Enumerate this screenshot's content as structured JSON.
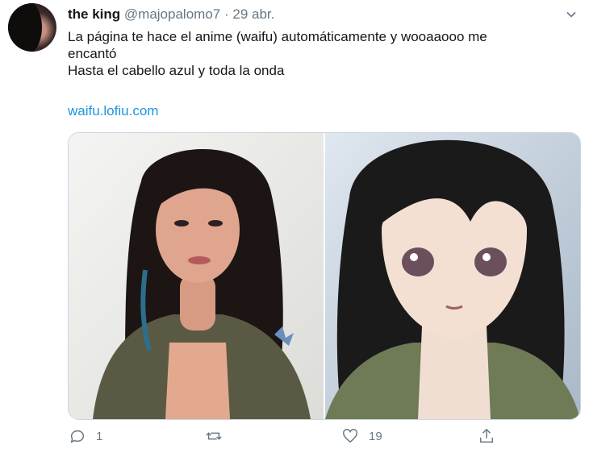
{
  "tweet": {
    "display_name": "the king",
    "handle": "@majopalomo7",
    "separator": "·",
    "date": "29 abr.",
    "text_lines": [
      "La página te hace el anime (waifu) automáticamente y wooaaooo me",
      "encantó",
      "Hasta el cabello azul y toda la onda"
    ],
    "link": "waifu.lofiu.com"
  },
  "actions": {
    "reply_count": "1",
    "retweet_count": "",
    "like_count": "19"
  },
  "icons": {
    "menu": "chevron-down-icon",
    "reply": "reply-icon",
    "retweet": "retweet-icon",
    "like": "heart-icon",
    "share": "share-icon"
  },
  "colors": {
    "link": "#1b95e0",
    "muted": "#657786",
    "text": "#14171a"
  }
}
